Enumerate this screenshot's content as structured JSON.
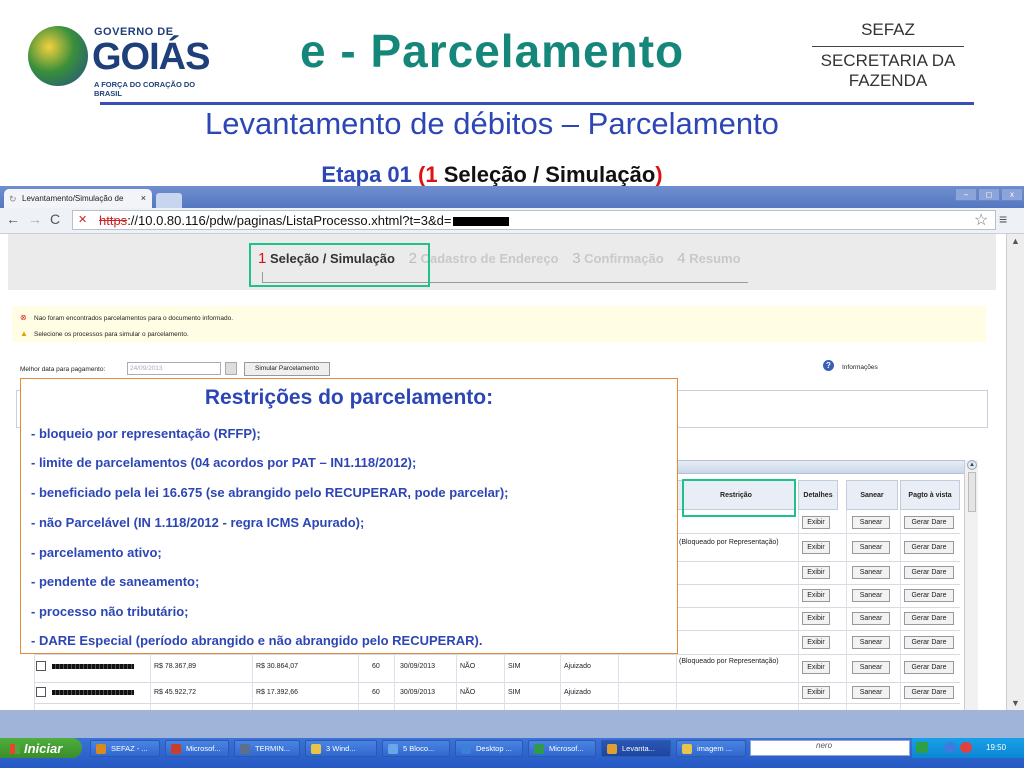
{
  "slide": {
    "logo_top": "GOVERNO DE",
    "logo_name": "GOIÁS",
    "logo_tagline": "A FORÇA DO CORAÇÃO DO BRASIL",
    "main_title": "e - Parcelamento",
    "sefaz_line1": "SEFAZ",
    "sefaz_line2": "SECRETARIA DA",
    "sefaz_line3": "FAZENDA",
    "subtitle": "Levantamento de débitos – Parcelamento",
    "step_prefix": "Etapa 01 ",
    "step_paren_open": "(",
    "step_num": "1",
    "step_name": " Seleção / Simulação",
    "step_paren_close": ")"
  },
  "browser": {
    "tab_title": "Levantamento/Simulação de",
    "tab_close": "×",
    "url_scheme": "https",
    "url_rest": "://10.0.80.116/pdw/paginas/ListaProcesso.xhtml?t=3&d=",
    "win_min": "–",
    "win_max": "◻",
    "win_close": "x"
  },
  "wizard": {
    "steps": [
      {
        "num": "1",
        "label": "Seleção / Simulação"
      },
      {
        "num": "2",
        "label": "Cadastro de Endereço"
      },
      {
        "num": "3",
        "label": "Confirmação"
      },
      {
        "num": "4",
        "label": "Resumo"
      }
    ]
  },
  "messages": {
    "error": "Nao foram encontrados parcelamentos para o documento informado.",
    "warning": "Selecione os processos para simular o parcelamento."
  },
  "form": {
    "date_label": "Melhor data para pagamento:",
    "date_value": "24/09/2013",
    "simulate_button": "Simular Parcelamento",
    "info_label": "Informações"
  },
  "restrictions": {
    "title": "Restrições do parcelamento:",
    "items": [
      "- bloqueio por representação (RFFP);",
      "- limite de parcelamentos (04 acordos por PAT – IN1.118/2012);",
      "- beneficiado pela lei 16.675 (se abrangido pelo RECUPERAR, pode parcelar);",
      "- não Parcelável (IN 1.118/2012 - regra ICMS Apurado);",
      "- parcelamento ativo;",
      "- pendente de saneamento;",
      "- processo não tributário;",
      "- DARE Especial (período abrangido e não abrangido pelo RECUPERAR)."
    ]
  },
  "grid": {
    "headers": {
      "restricao": "Restrição",
      "detalhes": "Detalhes",
      "sanear": "Sanear",
      "pagto": "Pagto à vista"
    },
    "button_exibir": "Exibir",
    "button_sanear": "Sanear",
    "button_gerar": "Gerar Dare",
    "bloqueado_text": "(Bloqueado por Representação)",
    "visible_rows": [
      {
        "valor": "R$ 78.367,89",
        "saldo": "R$ 30.864,07",
        "parcelas": "60",
        "data": "30/09/2013",
        "flag1": "NÃO",
        "flag2": "SIM",
        "situacao": "Ajuizado"
      },
      {
        "valor": "R$ 45.922,72",
        "saldo": "R$ 17.392,66",
        "parcelas": "60",
        "data": "30/09/2013",
        "flag1": "NÃO",
        "flag2": "SIM",
        "situacao": "Ajuizado"
      }
    ]
  },
  "taskbar": {
    "start": "Iniciar",
    "tasks": [
      {
        "label": "SEFAZ - ...",
        "color": "#d98a1e"
      },
      {
        "label": "Microsof...",
        "color": "#c8402a"
      },
      {
        "label": "TERMIN...",
        "color": "#5c6f8e"
      },
      {
        "label": "3 Wind...",
        "color": "#e8c54a"
      },
      {
        "label": "5 Bloco...",
        "color": "#6aa6e8"
      },
      {
        "label": "Desktop ...",
        "color": "#3c7fd8"
      },
      {
        "label": "Microsof...",
        "color": "#2f9a4a"
      },
      {
        "label": "Levanta...",
        "color": "#e0a030"
      },
      {
        "label": "imagem ...",
        "color": "#e8c54a"
      }
    ],
    "tray_brand": "nero",
    "clock": "19:50"
  }
}
